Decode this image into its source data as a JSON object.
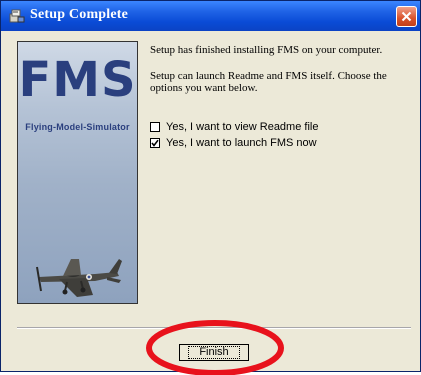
{
  "window": {
    "title": "Setup Complete"
  },
  "banner": {
    "logo_text": "FMS",
    "logo_subtitle": "Flying-Model-Simulator"
  },
  "content": {
    "paragraph_1": "Setup has finished installing FMS on your computer.",
    "paragraph_2": "Setup can launch Readme and FMS itself. Choose the options you want below."
  },
  "options": [
    {
      "label": "Yes, I want to view Readme file",
      "checked": false
    },
    {
      "label": "Yes, I want to launch FMS now",
      "checked": true
    }
  ],
  "buttons": {
    "finish_label": "Finish"
  },
  "colors": {
    "titlebar": "#0b43c4",
    "close_button": "#d9522b",
    "dialog_bg": "#ece9d8",
    "annotation_circle": "#e8121c",
    "logo_text": "#2a3f7e"
  }
}
